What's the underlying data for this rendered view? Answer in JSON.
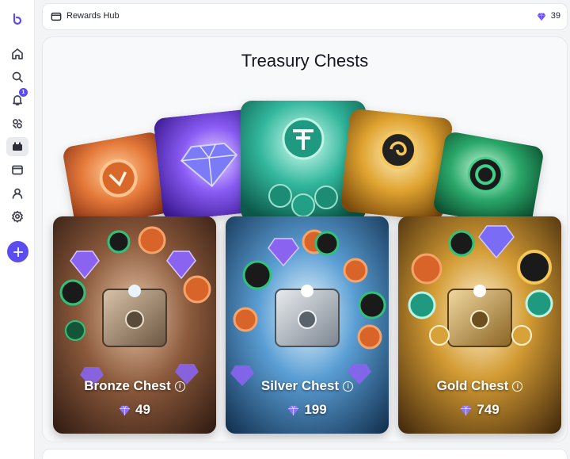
{
  "sidebar": {
    "items": [
      {
        "icon": "logo-icon"
      },
      {
        "icon": "home-icon"
      },
      {
        "icon": "search-icon"
      },
      {
        "icon": "bell-icon",
        "badge": "1"
      },
      {
        "icon": "gear-cluster-icon"
      },
      {
        "icon": "cards-icon",
        "active": true
      },
      {
        "icon": "wallet-icon"
      },
      {
        "icon": "user-icon"
      },
      {
        "icon": "settings-icon"
      }
    ],
    "add_icon": "plus-icon"
  },
  "header": {
    "title": "Rewards Hub",
    "gem_balance": "39",
    "icon": "wallet-icon",
    "gem_icon": "gem-icon"
  },
  "main": {
    "title": "Treasury Chests",
    "preview_cards": [
      {
        "theme": "bronze-coin",
        "color": "#e47a3a"
      },
      {
        "theme": "diamond",
        "color": "#7b5cf0"
      },
      {
        "theme": "tether-coin",
        "color": "#1ea58e"
      },
      {
        "theme": "gold-swirl-coin",
        "color": "#e0a430"
      },
      {
        "theme": "green-ring-coin",
        "color": "#2aa86a"
      }
    ],
    "chests": [
      {
        "name": "Bronze Chest",
        "price": "49",
        "accent": "#8a5a3c"
      },
      {
        "name": "Silver Chest",
        "price": "199",
        "accent": "#3e7bb8"
      },
      {
        "name": "Gold Chest",
        "price": "749",
        "accent": "#c9922a"
      }
    ]
  }
}
